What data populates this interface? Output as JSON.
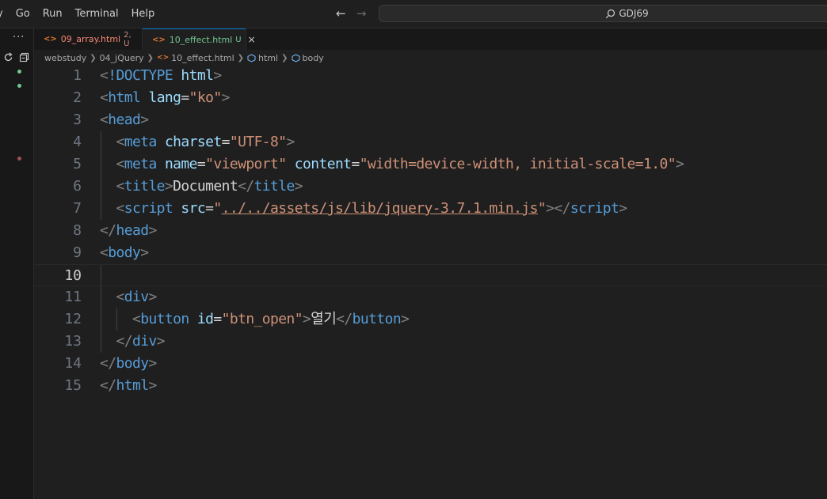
{
  "titlebar": {
    "menu": [
      "y",
      "Go",
      "Run",
      "Terminal",
      "Help"
    ],
    "search": "GDJ69"
  },
  "sidebar": {
    "more": "···"
  },
  "tabs": [
    {
      "label": "09_array.html",
      "status": "2, U",
      "active": false
    },
    {
      "label": "10_effect.html",
      "status": "U",
      "active": true,
      "close": "×"
    }
  ],
  "breadcrumbs": [
    "webstudy",
    "04_jQuery",
    "10_effect.html",
    "html",
    "body"
  ],
  "editor": {
    "active_line": 10,
    "lines": [
      {
        "num": "1"
      },
      {
        "num": "2"
      },
      {
        "num": "3"
      },
      {
        "num": "4"
      },
      {
        "num": "5"
      },
      {
        "num": "6"
      },
      {
        "num": "7"
      },
      {
        "num": "8"
      },
      {
        "num": "9"
      },
      {
        "num": "10"
      },
      {
        "num": "11"
      },
      {
        "num": "12"
      },
      {
        "num": "13"
      },
      {
        "num": "14"
      },
      {
        "num": "15"
      }
    ],
    "code": {
      "doctype": "!DOCTYPE",
      "html": "html",
      "lang_attr": "lang",
      "lang_val": "\"ko\"",
      "head": "head",
      "meta": "meta",
      "charset_attr": "charset",
      "charset_val": "\"UTF-8\"",
      "name_attr": "name",
      "name_val": "\"viewport\"",
      "content_attr": "content",
      "content_val": "\"width=device-width, initial-scale=1.0\"",
      "title": "title",
      "title_text": "Document",
      "script": "script",
      "src_attr": "src",
      "src_val": "../../assets/js/lib/jquery-3.7.1.min.js",
      "body": "body",
      "div": "div",
      "button": "button",
      "id_attr": "id",
      "id_val": "\"btn_open\"",
      "button_text": "열기"
    }
  },
  "colors": {
    "tag": "#569cd6",
    "attr": "#9cdcfe",
    "string": "#ce9178",
    "punct": "#808080",
    "active_tab_border": "#0078d4",
    "git_added": "#73c991"
  }
}
